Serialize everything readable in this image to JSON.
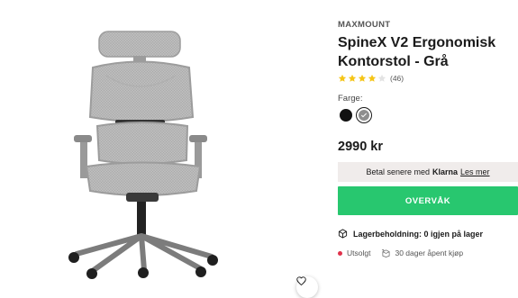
{
  "product": {
    "brand": "MAXMOUNT",
    "title": "SpineX V2 Ergonomisk Kontorstol - Grå",
    "rating": {
      "stars": 4,
      "max": 5,
      "count_label": "(46)"
    },
    "color_label": "Farge:",
    "swatches": [
      {
        "name": "black",
        "color": "#111111",
        "selected": false
      },
      {
        "name": "gray",
        "color": "#8e8e8e",
        "selected": true
      }
    ],
    "price": "2990 kr"
  },
  "klarna": {
    "prefix": "Betal senere med",
    "brand": "Klarna",
    "link": "Les mer"
  },
  "cta": {
    "label": "OVERVÅK",
    "color": "#28c76f"
  },
  "stock": {
    "label": "Lagerbeholdning: 0 igjen på lager"
  },
  "status": {
    "sold_out": "Utsolgt",
    "sold_out_color": "#e0324b",
    "return_policy": "30 dager åpent kjøp"
  },
  "icons": {
    "wishlist": "heart-icon",
    "stock": "box-icon",
    "return": "return-box-icon"
  }
}
